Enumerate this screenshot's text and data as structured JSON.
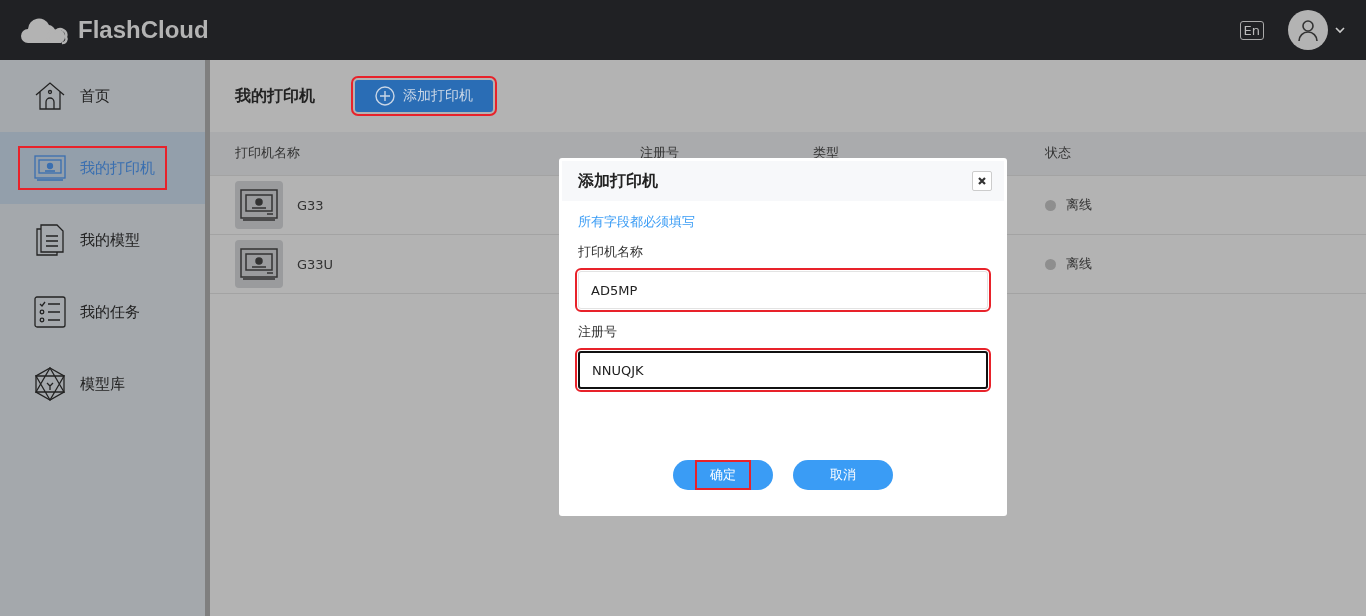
{
  "header": {
    "logo": "FlashCloud",
    "language": "En"
  },
  "sidebar": {
    "items": [
      {
        "label": "首页",
        "kind": "home",
        "selected": false,
        "highlighted": false
      },
      {
        "label": "我的打印机",
        "kind": "printer",
        "selected": true,
        "highlighted": true
      },
      {
        "label": "我的模型",
        "kind": "models",
        "selected": false,
        "highlighted": false
      },
      {
        "label": "我的任务",
        "kind": "tasks",
        "selected": false,
        "highlighted": false
      },
      {
        "label": "模型库",
        "kind": "library",
        "selected": false,
        "highlighted": false
      }
    ]
  },
  "page": {
    "title": "我的打印机",
    "add_button": {
      "label": "添加打印机",
      "highlighted": true
    }
  },
  "table": {
    "columns": [
      "打印机名称",
      "注册号",
      "类型",
      "状态"
    ],
    "rows": [
      {
        "name": "G33",
        "status": "离线"
      },
      {
        "name": "G33U",
        "status": "离线"
      }
    ]
  },
  "dialog": {
    "title": "添加打印机",
    "note": "所有字段都必须填写",
    "fields": [
      {
        "label": "打印机名称",
        "value": "AD5MP",
        "focused": false,
        "highlighted": true
      },
      {
        "label": "注册号",
        "value": "NNUQJK",
        "focused": true,
        "highlighted": true
      }
    ],
    "buttons": [
      {
        "label": "确定",
        "highlighted": true
      },
      {
        "label": "取消",
        "highlighted": false
      }
    ]
  }
}
